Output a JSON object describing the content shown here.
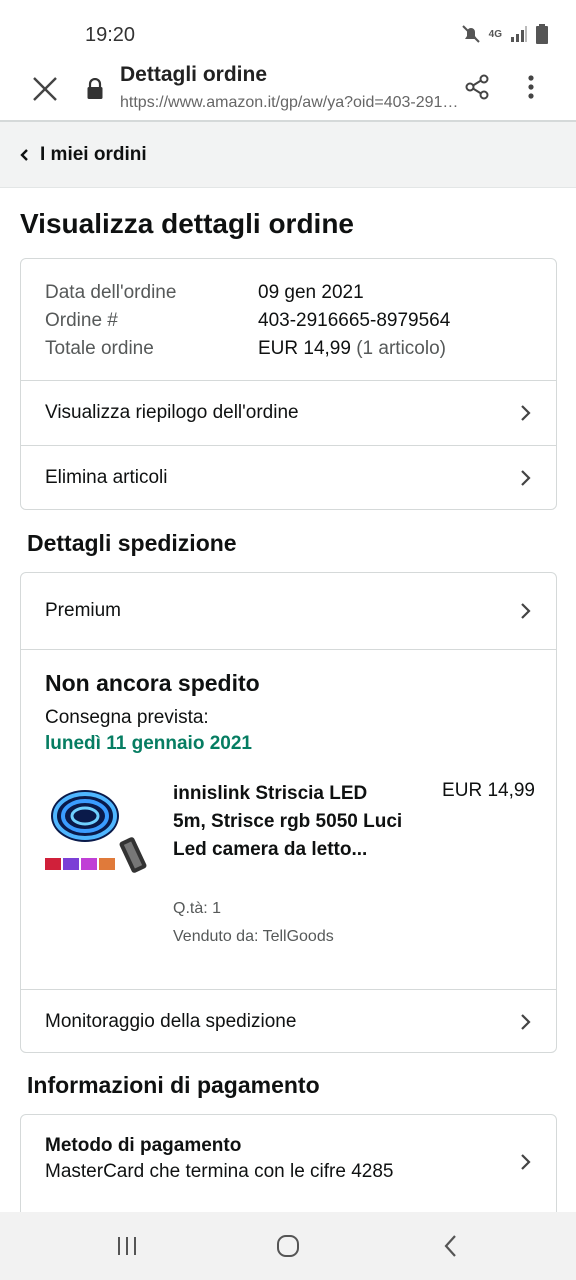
{
  "status_bar": {
    "time": "19:20",
    "network": "4G"
  },
  "browser": {
    "title": "Dettagli ordine",
    "url": "https://www.amazon.it/gp/aw/ya?oid=403-291…"
  },
  "back_nav": {
    "label": "I miei ordini"
  },
  "page": {
    "title": "Visualizza dettagli ordine"
  },
  "order": {
    "date_label": "Data dell'ordine",
    "date_value": "09 gen 2021",
    "number_label": "Ordine #",
    "number_value": "403-2916665-8979564",
    "total_label": "Totale ordine",
    "total_value": "EUR 14,99",
    "total_items": "(1 articolo)",
    "summary_link": "Visualizza riepilogo dell'ordine",
    "delete_link": "Elimina articoli"
  },
  "shipping": {
    "section_title": "Dettagli spedizione",
    "method": "Premium",
    "status": "Non ancora spedito",
    "expected_label": "Consegna prevista:",
    "expected_date": "lunedì 11 gennaio 2021",
    "product": {
      "name": "innislink Striscia LED 5m, Strisce rgb 5050 Luci Led camera da letto...",
      "price": "EUR 14,99",
      "qty": "Q.tà: 1",
      "seller": "Venduto da: TellGoods"
    },
    "tracking_link": "Monitoraggio della spedizione"
  },
  "payment": {
    "section_title": "Informazioni di pagamento",
    "method_title": "Metodo di pagamento",
    "method_desc": "MasterCard che termina con le cifre 4285"
  },
  "colors": {
    "accent_green": "#067d62",
    "text": "#0f1111",
    "muted": "#565959",
    "border": "#d5d9d9"
  }
}
